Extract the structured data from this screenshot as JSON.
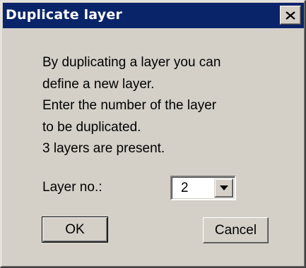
{
  "window": {
    "title": "Duplicate layer",
    "close_label": "Close"
  },
  "message": {
    "lines": [
      "By duplicating a layer you can",
      "define a new layer.",
      "Enter the number of the layer",
      "to be duplicated.",
      "3 layers are present."
    ]
  },
  "layer_field": {
    "label": "Layer no.:",
    "selected_value": "2"
  },
  "buttons": {
    "ok_label": "OK",
    "cancel_label": "Cancel"
  },
  "icons": {
    "close": "close-icon",
    "dropdown": "chevron-down-icon"
  },
  "colors": {
    "titlebar": "#0a246a",
    "face": "#d4d0c8"
  }
}
